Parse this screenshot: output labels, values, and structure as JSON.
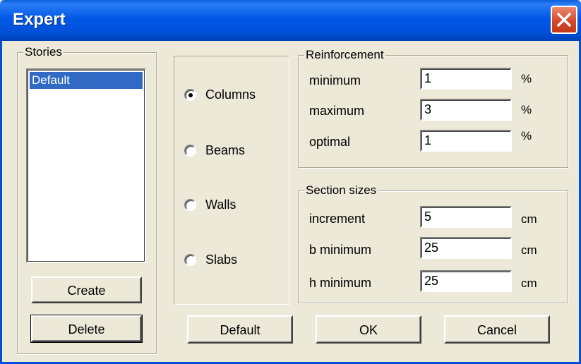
{
  "window": {
    "title": "Expert"
  },
  "stories": {
    "label": "Stories",
    "items": [
      "Default"
    ],
    "create_label": "Create",
    "delete_label": "Delete"
  },
  "elements": {
    "options": [
      "Columns",
      "Beams",
      "Walls",
      "Slabs"
    ],
    "selected": "Columns"
  },
  "reinforcement": {
    "label": "Reinforcement",
    "rows": [
      {
        "label": "minimum",
        "value": "1",
        "unit": "%"
      },
      {
        "label": "maximum",
        "value": "3",
        "unit": "%"
      },
      {
        "label": "optimal",
        "value": "1",
        "unit": "%"
      }
    ]
  },
  "section_sizes": {
    "label": "Section sizes",
    "rows": [
      {
        "label": "increment",
        "value": "5",
        "unit": "cm"
      },
      {
        "label": "b minimum",
        "value": "25",
        "unit": "cm"
      },
      {
        "label": "h minimum",
        "value": "25",
        "unit": "cm"
      }
    ]
  },
  "footer": {
    "default_label": "Default",
    "ok_label": "OK",
    "cancel_label": "Cancel"
  }
}
